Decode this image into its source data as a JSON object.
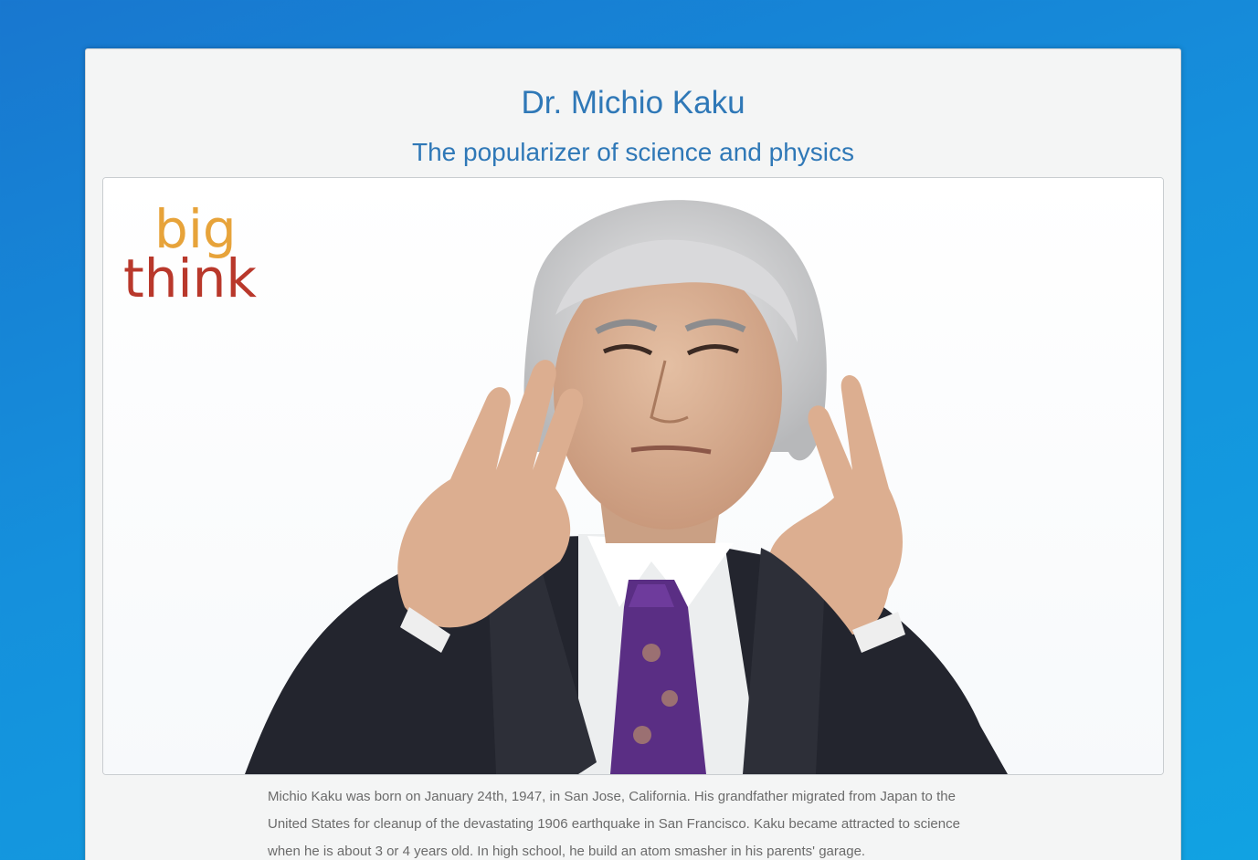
{
  "page": {
    "title": "Dr. Michio Kaku",
    "subtitle": "The popularizer of science and physics"
  },
  "image": {
    "logo_text": "big think",
    "description_icon": "portrait-photo"
  },
  "bio": {
    "text": "Michio Kaku was born on January 24th, 1947, in San Jose, California. His grandfather migrated from Japan to the United States for cleanup of the devastating 1906 earthquake in San Francisco. Kaku became attracted to science when he is about 3 or 4 years old. In high school, he build an atom smasher in his parents' garage."
  },
  "colors": {
    "heading": "#2f78b7",
    "body_text": "#6b6b6b",
    "logo_top": "#e7a33a",
    "logo_bottom": "#b5352a"
  }
}
